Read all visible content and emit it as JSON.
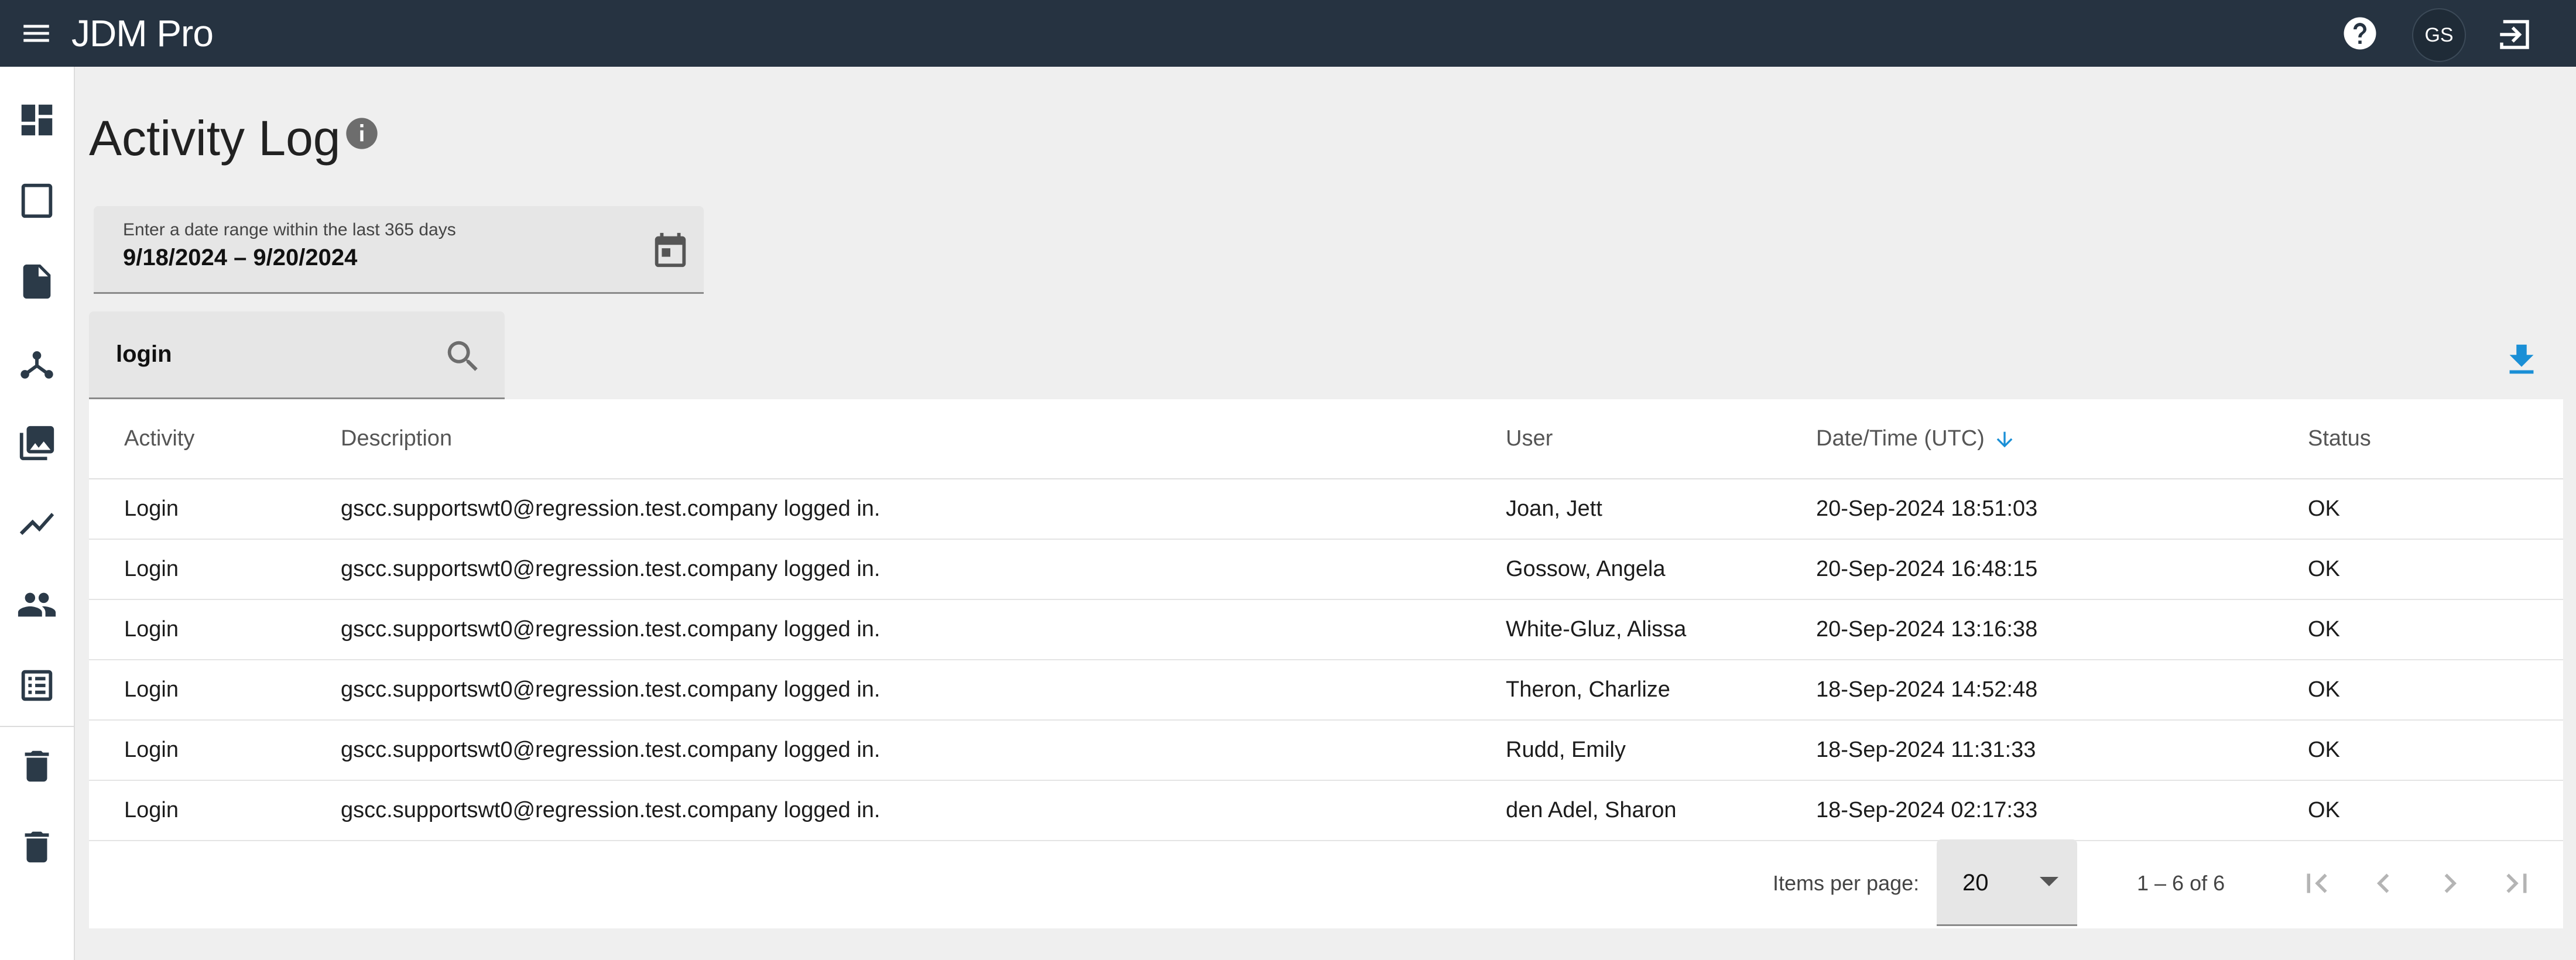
{
  "app": {
    "title": "JDM Pro",
    "avatar_initials": "GS"
  },
  "sidebar": {
    "items": [
      {
        "icon": "dashboard-icon"
      },
      {
        "icon": "tablet-icon"
      },
      {
        "icon": "document-icon"
      },
      {
        "icon": "hub-icon"
      },
      {
        "icon": "photo-library-icon"
      },
      {
        "icon": "trending-icon"
      },
      {
        "icon": "people-icon"
      },
      {
        "icon": "list-icon"
      },
      {
        "icon": "delete-icon"
      },
      {
        "icon": "delete-icon"
      }
    ]
  },
  "page": {
    "title": "Activity Log"
  },
  "date_range": {
    "label": "Enter a date range within the last 365 days",
    "value": "9/18/2024 – 9/20/2024"
  },
  "search": {
    "value": "login"
  },
  "table": {
    "columns": [
      "Activity",
      "Description",
      "User",
      "Date/Time (UTC)",
      "Status"
    ],
    "sort": {
      "column": "Date/Time (UTC)",
      "direction": "descending"
    },
    "rows": [
      {
        "activity": "Login",
        "description": "gscc.supportswt0@regression.test.company logged in.",
        "user": "Joan, Jett",
        "datetime": "20-Sep-2024 18:51:03",
        "status": "OK"
      },
      {
        "activity": "Login",
        "description": "gscc.supportswt0@regression.test.company logged in.",
        "user": "Gossow, Angela",
        "datetime": "20-Sep-2024 16:48:15",
        "status": "OK"
      },
      {
        "activity": "Login",
        "description": "gscc.supportswt0@regression.test.company logged in.",
        "user": "White-Gluz, Alissa",
        "datetime": "20-Sep-2024 13:16:38",
        "status": "OK"
      },
      {
        "activity": "Login",
        "description": "gscc.supportswt0@regression.test.company logged in.",
        "user": "Theron, Charlize",
        "datetime": "18-Sep-2024 14:52:48",
        "status": "OK"
      },
      {
        "activity": "Login",
        "description": "gscc.supportswt0@regression.test.company logged in.",
        "user": "Rudd, Emily",
        "datetime": "18-Sep-2024 11:31:33",
        "status": "OK"
      },
      {
        "activity": "Login",
        "description": "gscc.supportswt0@regression.test.company logged in.",
        "user": "den Adel, Sharon",
        "datetime": "18-Sep-2024 02:17:33",
        "status": "OK"
      }
    ]
  },
  "paginator": {
    "items_per_page_label": "Items per page:",
    "items_per_page": "20",
    "range": "1 – 6 of 6"
  },
  "colors": {
    "topbar": "#263341",
    "accent": "#1a8fd6",
    "background": "#efefef"
  }
}
